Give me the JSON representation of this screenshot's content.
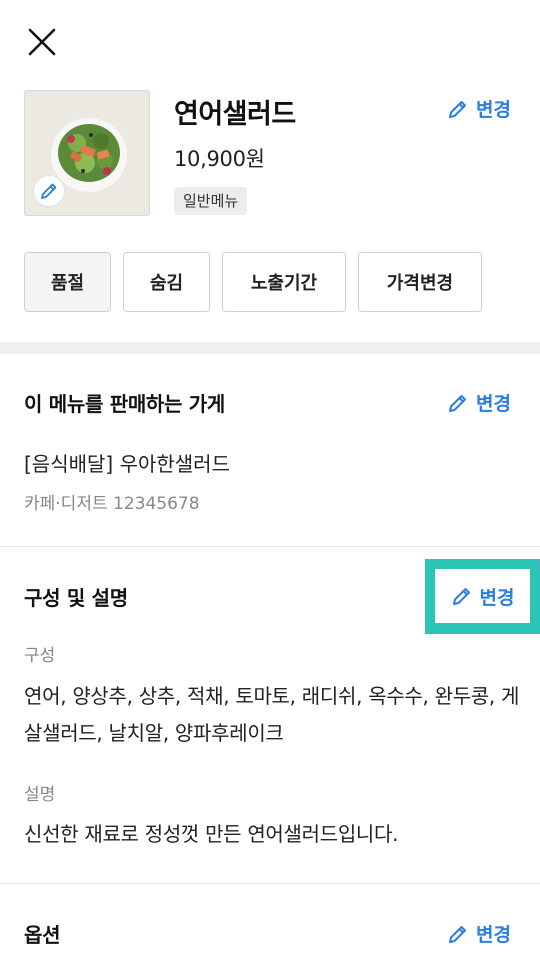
{
  "header": {
    "close_icon": "close-icon"
  },
  "menu": {
    "name": "연어샐러드",
    "price": "10,900원",
    "badge": "일반메뉴",
    "edit_label": "변경"
  },
  "actions": [
    {
      "label": "품절"
    },
    {
      "label": "숨김"
    },
    {
      "label": "노출기간"
    },
    {
      "label": "가격변경"
    }
  ],
  "store_section": {
    "title": "이 메뉴를 판매하는 가게",
    "edit_label": "변경",
    "store_name": "[음식배달] 우아한샐러드",
    "store_meta": "카페·디저트 12345678"
  },
  "composition_section": {
    "title": "구성 및 설명",
    "edit_label": "변경",
    "composition_label": "구성",
    "composition_text": "연어, 양상추, 상추, 적채, 토마토, 래디쉬, 옥수수, 완두콩, 게살샐러드, 날치알, 양파후레이크",
    "description_label": "설명",
    "description_text": "신선한 재료로 정성껏 만든 연어샐러드입니다."
  },
  "options_section": {
    "title": "옵션",
    "edit_label": "변경"
  },
  "colors": {
    "accent_blue": "#2a7de1",
    "highlight_teal": "#2cc4b5"
  }
}
